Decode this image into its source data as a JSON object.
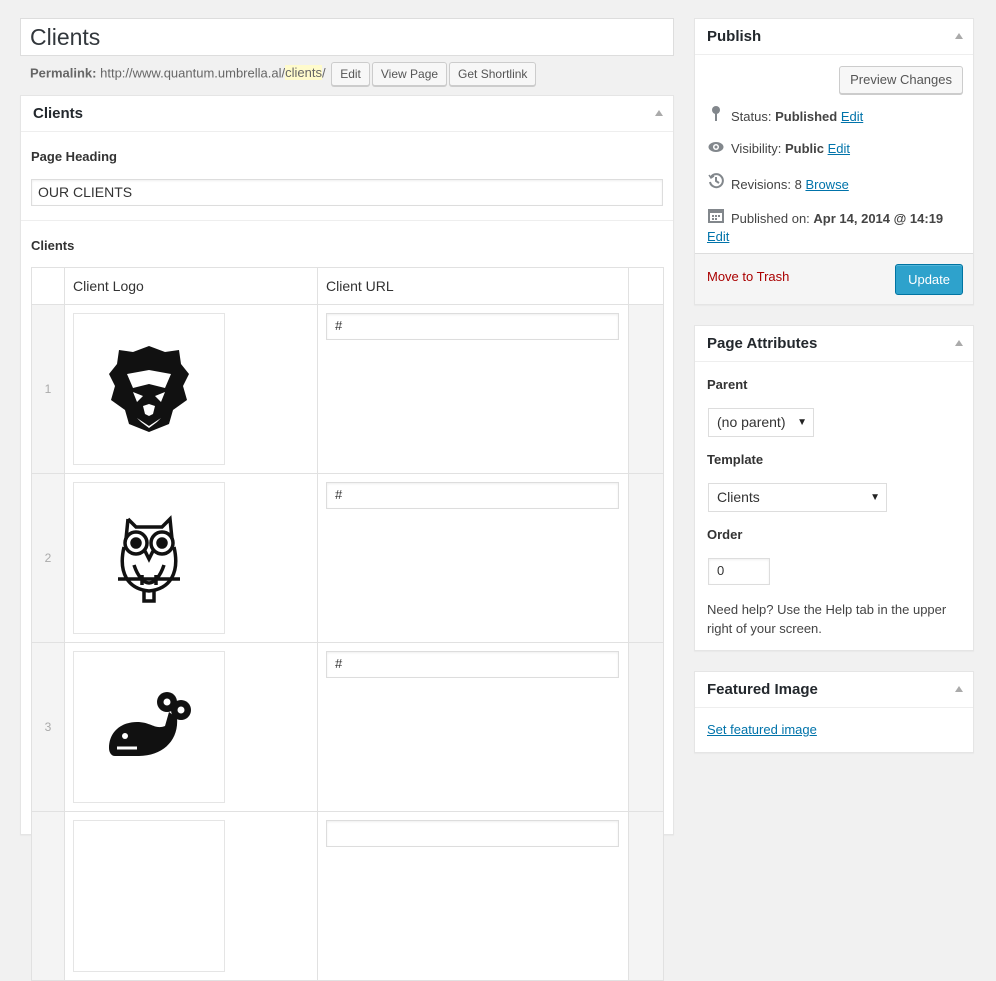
{
  "title_value": "Clients",
  "permalink": {
    "label": "Permalink:",
    "base": "http://www.quantum.umbrella.al/",
    "slug": "clients",
    "trail": "/",
    "buttons": [
      "Edit",
      "View Page",
      "Get Shortlink"
    ]
  },
  "clients_box": {
    "title": "Clients",
    "page_heading_label": "Page Heading",
    "page_heading_value": "OUR CLIENTS",
    "clients_label": "Clients",
    "columns": [
      "Client Logo",
      "Client URL"
    ],
    "rows": [
      {
        "order": "1",
        "logo_icon": "lion-logo-icon",
        "url": "#"
      },
      {
        "order": "2",
        "logo_icon": "owl-logo-icon",
        "url": "#"
      },
      {
        "order": "3",
        "logo_icon": "whale-logo-icon",
        "url": "#"
      }
    ]
  },
  "publish": {
    "title": "Publish",
    "preview_label": "Preview Changes",
    "status_label": "Status:",
    "status_value": "Published",
    "visibility_label": "Visibility:",
    "visibility_value": "Public",
    "revisions_label": "Revisions:",
    "revisions_value": "8",
    "browse_label": "Browse",
    "published_on_label": "Published on:",
    "published_on_value": "Apr 14, 2014 @ 14:19",
    "edit_label": "Edit",
    "trash_label": "Move to Trash",
    "update_label": "Update"
  },
  "attributes": {
    "title": "Page Attributes",
    "parent_label": "Parent",
    "parent_value": "(no parent)",
    "template_label": "Template",
    "template_value": "Clients",
    "order_label": "Order",
    "order_value": "0",
    "help_text": "Need help? Use the Help tab in the upper right of your screen."
  },
  "featured": {
    "title": "Featured Image",
    "link_label": "Set featured image"
  },
  "colors": {
    "primary_button": "#2ea2cc",
    "link": "#0073aa",
    "trash": "#aa0000",
    "slug_highlight": "#fffbcc"
  }
}
